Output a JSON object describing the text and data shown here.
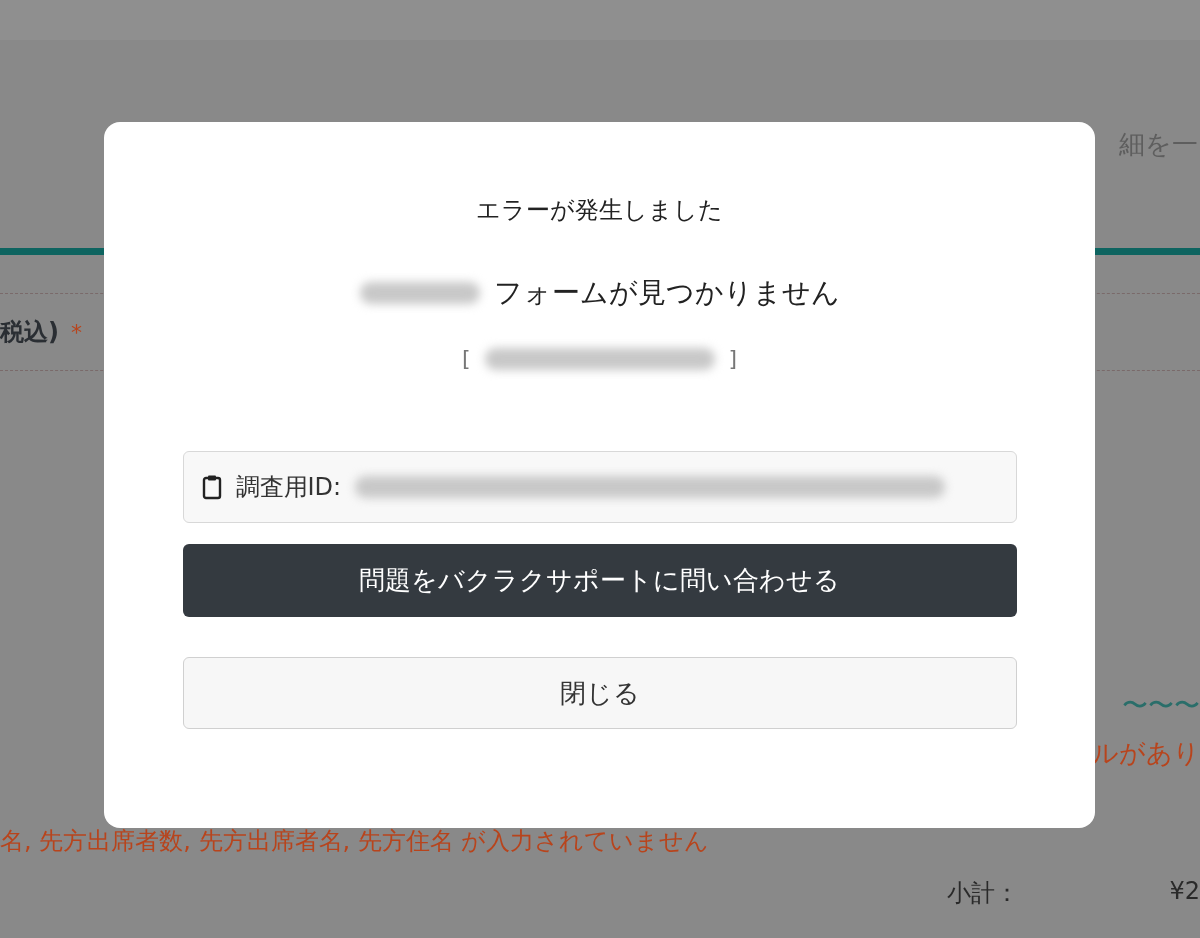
{
  "background": {
    "header_text": "細を一",
    "field_label": "税込)",
    "required_mark": "*",
    "wave_text": "〜〜〜",
    "notice_text": "ルがあり",
    "error_text": "名, 先方出席者数, 先方出席者名, 先方住名 が入力されていません",
    "subtotal_label": "小計：",
    "subtotal_value": "¥2"
  },
  "dialog": {
    "title": "エラーが発生しました",
    "message": "フォームが見つかりません",
    "bracket_open": "[",
    "bracket_close": "]",
    "id_label": "調査用ID:",
    "contact_button": "問題をバクラクサポートに問い合わせる",
    "close_button": "閉じる"
  }
}
